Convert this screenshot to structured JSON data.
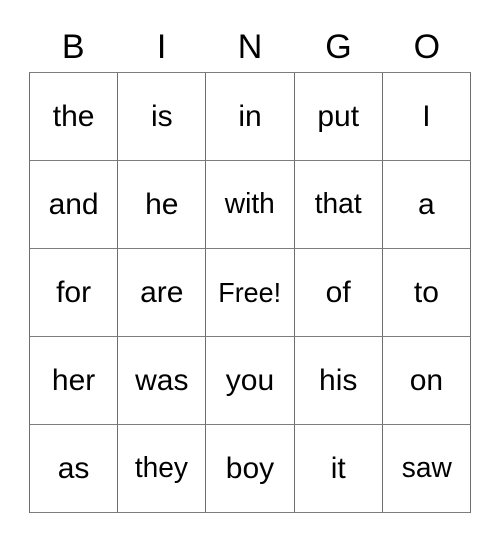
{
  "card": {
    "title": "BINGO",
    "headers": [
      "B",
      "I",
      "N",
      "G",
      "O"
    ],
    "free_space": "Free!",
    "colors": {
      "background": "#ffffff",
      "text": "#000000",
      "grid_line": "#6e6e6e"
    },
    "grid": {
      "columns": 5,
      "rows": 5,
      "rows_data": [
        {
          "cells": [
            "the",
            "is",
            "in",
            "put",
            "I"
          ]
        },
        {
          "cells": [
            "and",
            "he",
            "with",
            "that",
            "a"
          ]
        },
        {
          "cells": [
            "for",
            "are",
            "Free!",
            "of",
            "to"
          ]
        },
        {
          "cells": [
            "her",
            "was",
            "you",
            "his",
            "on"
          ]
        },
        {
          "cells": [
            "as",
            "they",
            "boy",
            "it",
            "saw"
          ]
        }
      ]
    }
  }
}
